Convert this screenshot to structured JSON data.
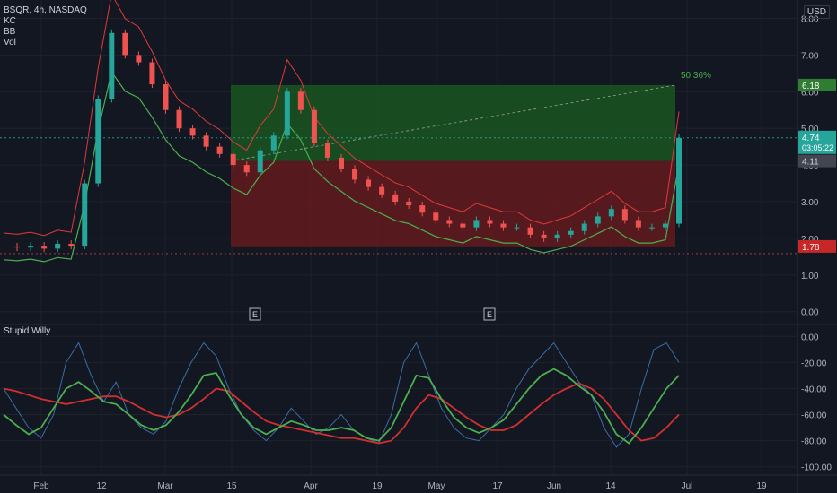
{
  "header": {
    "symbol": "BSQR, 4h, NASDAQ",
    "indicators": [
      "KC",
      "BB",
      "Vol"
    ],
    "currency": "USD"
  },
  "oscillator": {
    "name": "Stupid Willy"
  },
  "colors": {
    "bg": "#131722",
    "grid": "#1e222d",
    "axis_text": "#b2b5be",
    "candle_up": "#26a69a",
    "candle_down": "#ef5350",
    "kc_line": "#e03a3a",
    "bb_line": "#4caf50",
    "profit_zone": "#1b5e20",
    "loss_zone": "#6d1b1e",
    "osc_line": "#3a6ea5",
    "osc_red": "#d32f2f",
    "osc_green": "#4caf50",
    "label_green": "#2e7d32",
    "label_red": "#c62828",
    "label_gray": "#434651"
  },
  "chart_data": [
    {
      "type": "line",
      "title": "BSQR, 4h, NASDAQ",
      "x_ticks": [
        "Feb",
        "12",
        "Mar",
        "15",
        "Apr",
        "19",
        "May",
        "17",
        "Jun",
        "14",
        "Jul",
        "19"
      ],
      "y_ticks": [
        "0.00",
        "1.00",
        "2.00",
        "3.00",
        "4.00",
        "5.00",
        "6.00",
        "7.00",
        "8.00"
      ],
      "ylim": [
        -0.3,
        8.5
      ],
      "series": [
        {
          "values": [
            1.78,
            1.75,
            1.8,
            1.72,
            1.85,
            1.8,
            3.5,
            5.8,
            7.6,
            7.0,
            6.8,
            6.2,
            5.5,
            5.0,
            4.8,
            4.5,
            4.3,
            4.0,
            3.8,
            4.4,
            4.8,
            6.0,
            5.5,
            4.6,
            4.2,
            3.9,
            3.6,
            3.4,
            3.2,
            3.0,
            2.9,
            2.7,
            2.5,
            2.4,
            2.3,
            2.5,
            2.4,
            2.3,
            2.3,
            2.1,
            2.0,
            2.1,
            2.2,
            2.4,
            2.6,
            2.8,
            2.5,
            2.3,
            2.3,
            2.4,
            4.74
          ]
        }
      ],
      "position_tool": {
        "entry": 4.11,
        "target": 6.18,
        "stop": 1.78,
        "gain_label": "50.36%"
      },
      "price_labels": {
        "target": "6.18",
        "current": "4.74",
        "countdown": "03:05:22",
        "entry": "4.11",
        "stop": "1.78"
      },
      "earnings_markers": [
        "E",
        "E"
      ]
    },
    {
      "type": "line",
      "title": "Stupid Willy",
      "y_ticks": [
        "0.00",
        "-20.00",
        "-40.00",
        "-60.00",
        "-80.00",
        "-100.00"
      ],
      "ylim": [
        -105,
        5
      ],
      "series": [
        {
          "values": [
            -40,
            -55,
            -70,
            -78,
            -60,
            -20,
            -5,
            -30,
            -50,
            -35,
            -60,
            -70,
            -75,
            -65,
            -40,
            -20,
            -5,
            -15,
            -40,
            -60,
            -72,
            -80,
            -70,
            -55,
            -65,
            -75,
            -70,
            -60,
            -72,
            -78,
            -82,
            -60,
            -20,
            -5,
            -30,
            -55,
            -70,
            -78,
            -80,
            -70,
            -60,
            -40,
            -25,
            -15,
            -5,
            -20,
            -35,
            -45,
            -70,
            -85,
            -75,
            -40,
            -10,
            -5,
            -20
          ]
        },
        {
          "values": [
            -40,
            -42,
            -45,
            -48,
            -50,
            -52,
            -50,
            -48,
            -46,
            -46,
            -50,
            -55,
            -60,
            -62,
            -60,
            -55,
            -48,
            -40,
            -42,
            -50,
            -58,
            -65,
            -68,
            -70,
            -72,
            -74,
            -76,
            -78,
            -78,
            -80,
            -82,
            -80,
            -70,
            -55,
            -45,
            -48,
            -55,
            -62,
            -68,
            -72,
            -72,
            -68,
            -60,
            -52,
            -45,
            -40,
            -36,
            -40,
            -48,
            -60,
            -72,
            -80,
            -78,
            -70,
            -60
          ]
        },
        {
          "values": [
            -60,
            -68,
            -75,
            -70,
            -55,
            -40,
            -35,
            -42,
            -50,
            -52,
            -60,
            -68,
            -72,
            -68,
            -58,
            -45,
            -30,
            -28,
            -45,
            -60,
            -70,
            -75,
            -70,
            -65,
            -68,
            -72,
            -72,
            -70,
            -72,
            -78,
            -80,
            -70,
            -50,
            -30,
            -32,
            -48,
            -62,
            -70,
            -74,
            -70,
            -64,
            -52,
            -40,
            -30,
            -25,
            -30,
            -38,
            -45,
            -58,
            -75,
            -82,
            -70,
            -55,
            -40,
            -30
          ]
        }
      ]
    }
  ]
}
